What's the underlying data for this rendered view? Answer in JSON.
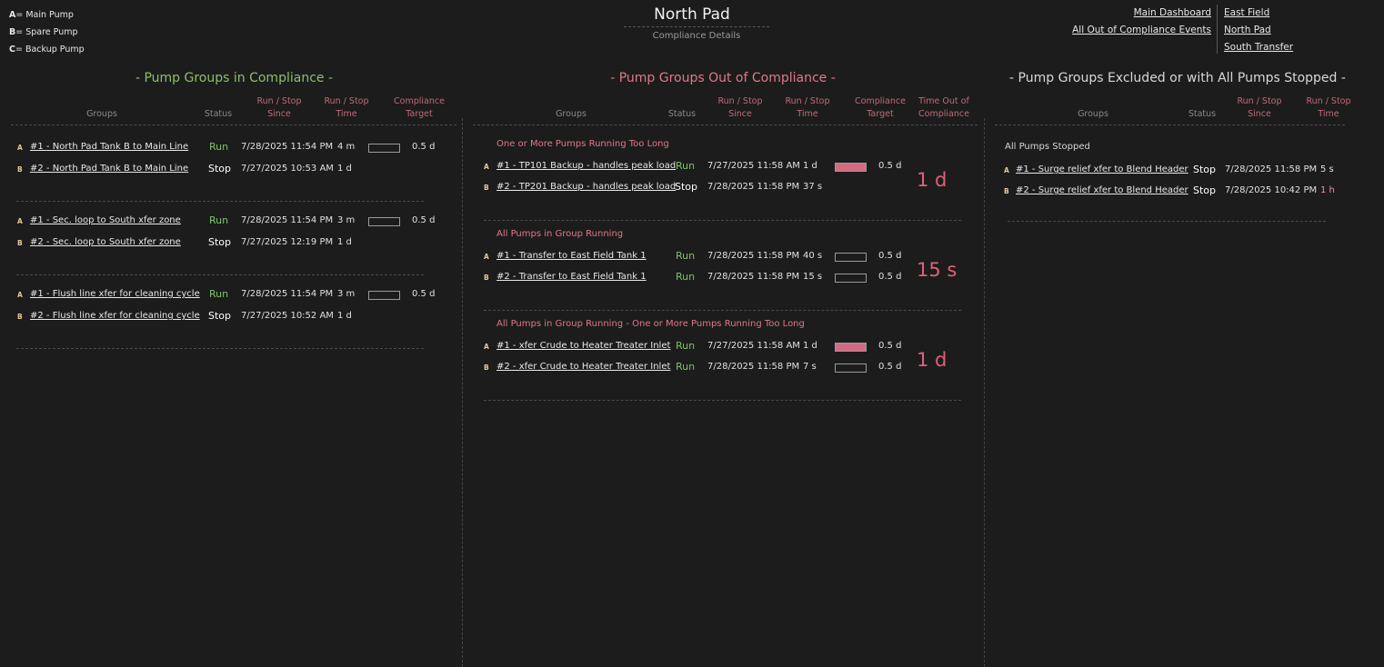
{
  "legend": [
    {
      "key": "A",
      "label": "= Main Pump"
    },
    {
      "key": "B",
      "label": "= Spare Pump"
    },
    {
      "key": "C",
      "label": "= Backup Pump"
    }
  ],
  "header": {
    "title": "North Pad",
    "subtitle": "Compliance Details"
  },
  "nav": {
    "left": [
      "Main Dashboard",
      "All Out of Compliance Events"
    ],
    "right": [
      "East Field",
      "North Pad",
      "South Transfer"
    ]
  },
  "colors": {
    "accent_green": "#8fbf6a",
    "accent_red": "#e0788a",
    "bar_fill": "#d46a82",
    "run": "#7cc36a"
  },
  "compliance": {
    "title": "- Pump Groups in Compliance -",
    "headers": [
      "Groups",
      "Status",
      "Run / Stop Since",
      "Run / Stop Time",
      "Compliance Target"
    ],
    "groups": [
      {
        "rows": [
          {
            "pump": "A",
            "name": "#1 - North Pad Tank B to Main Line",
            "status": "Run",
            "since": "7/28/2025 11:54 PM",
            "time": "4 m",
            "fill": 0,
            "target": "0.5 d"
          },
          {
            "pump": "B",
            "name": "#2 - North Pad Tank B to Main Line",
            "status": "Stop",
            "since": "7/27/2025 10:53 AM",
            "time": "1 d"
          }
        ]
      },
      {
        "rows": [
          {
            "pump": "A",
            "name": "#1 - Sec. loop to South xfer zone",
            "status": "Run",
            "since": "7/28/2025 11:54 PM",
            "time": "3 m",
            "fill": 0,
            "target": "0.5 d"
          },
          {
            "pump": "B",
            "name": "#2 - Sec. loop to South xfer zone",
            "status": "Stop",
            "since": "7/27/2025 12:19 PM",
            "time": "1 d"
          }
        ]
      },
      {
        "rows": [
          {
            "pump": "A",
            "name": "#1 - Flush line xfer for cleaning cycle",
            "status": "Run",
            "since": "7/28/2025 11:54 PM",
            "time": "3 m",
            "fill": 0,
            "target": "0.5 d"
          },
          {
            "pump": "B",
            "name": "#2 - Flush line xfer for cleaning cycle",
            "status": "Stop",
            "since": "7/27/2025 10:52 AM",
            "time": "1 d"
          }
        ]
      }
    ]
  },
  "out_of_compliance": {
    "title": "- Pump Groups Out of Compliance -",
    "headers": [
      "Groups",
      "Status",
      "Run / Stop Since",
      "Run / Stop Time",
      "Compliance Target",
      "Time Out of Compliance"
    ],
    "groups": [
      {
        "label": "One or More Pumps Running Too Long",
        "out_time": "1 d",
        "rows": [
          {
            "pump": "A",
            "name": "#1 - TP101 Backup - handles peak load",
            "status": "Run",
            "since": "7/27/2025 11:58 AM",
            "time": "1 d",
            "fill": 1,
            "target": "0.5 d"
          },
          {
            "pump": "B",
            "name": "#2 - TP201 Backup - handles peak load",
            "status": "Stop",
            "since": "7/28/2025 11:58 PM",
            "time": "37 s"
          }
        ]
      },
      {
        "label": "All Pumps in Group Running",
        "out_time": "15 s",
        "rows": [
          {
            "pump": "A",
            "name": "#1 - Transfer to East Field Tank 1",
            "status": "Run",
            "since": "7/28/2025 11:58 PM",
            "time": "40 s",
            "fill": 0,
            "target": "0.5 d"
          },
          {
            "pump": "B",
            "name": "#2 - Transfer to East Field Tank 1",
            "status": "Run",
            "since": "7/28/2025 11:58 PM",
            "time": "15 s",
            "fill": 0,
            "target": "0.5 d"
          }
        ]
      },
      {
        "label": "All Pumps in Group Running - One or More Pumps Running Too Long",
        "out_time": "1 d",
        "rows": [
          {
            "pump": "A",
            "name": "#1 - xfer Crude to Heater Treater Inlet",
            "status": "Run",
            "since": "7/27/2025 11:58 AM",
            "time": "1 d",
            "fill": 1,
            "target": "0.5 d"
          },
          {
            "pump": "B",
            "name": "#2 - xfer Crude to Heater Treater Inlet",
            "status": "Run",
            "since": "7/28/2025 11:58 PM",
            "time": "7 s",
            "fill": 0,
            "target": "0.5 d"
          }
        ]
      }
    ]
  },
  "excluded": {
    "title": "- Pump Groups Excluded or with All Pumps Stopped -",
    "headers": [
      "Groups",
      "Status",
      "Run / Stop Since",
      "Run / Stop Time"
    ],
    "groups": [
      {
        "label": "All Pumps Stopped",
        "rows": [
          {
            "pump": "A",
            "name": "#1 - Surge relief xfer to Blend Header",
            "status": "Stop",
            "since": "7/28/2025 11:58 PM",
            "time": "5 s"
          },
          {
            "pump": "B",
            "name": "#2 - Surge relief xfer to Blend Header",
            "status": "Stop",
            "since": "7/28/2025 10:42 PM",
            "time": "1 h"
          }
        ]
      }
    ]
  }
}
